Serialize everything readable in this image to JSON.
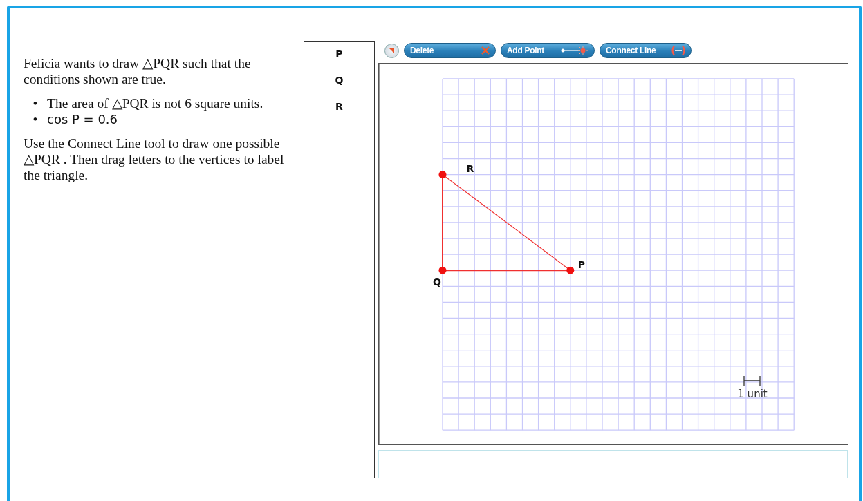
{
  "prompt": {
    "intro": "Felicia wants to draw △PQR such that the conditions shown are true.",
    "conditions": [
      {
        "bullet": "•",
        "text": "The area of △PQR is not 6 square units.",
        "kind": "text"
      },
      {
        "bullet": "•",
        "text": "cos  P = 0.6",
        "kind": "math"
      }
    ],
    "instruction": "Use the Connect Line tool to draw one possible △PQR . Then drag letters to the vertices to label the triangle."
  },
  "letter_bank": [
    "P",
    "Q",
    "R"
  ],
  "toolbar": {
    "delete": "Delete",
    "add_point": "Add Point",
    "connect_line": "Connect Line"
  },
  "graph": {
    "scale_label": "1 unit",
    "vertices": [
      {
        "label": "R"
      },
      {
        "label": "Q"
      },
      {
        "label": "P"
      }
    ]
  }
}
